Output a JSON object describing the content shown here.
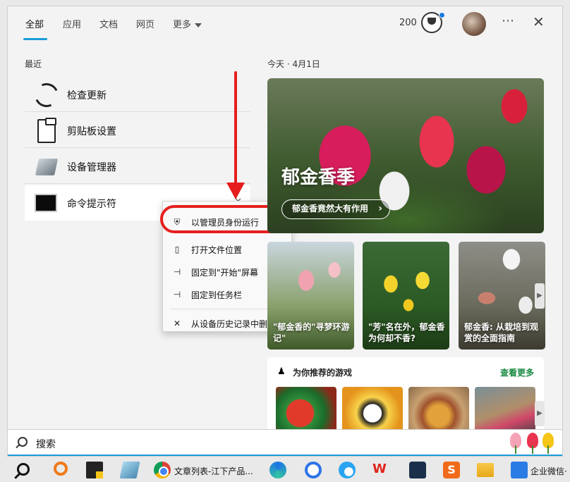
{
  "nav": {
    "tabs": [
      "全部",
      "应用",
      "文档",
      "网页",
      "更多"
    ],
    "points": "200"
  },
  "recent": {
    "label": "最近",
    "items": [
      {
        "label": "检查更新"
      },
      {
        "label": "剪贴板设置"
      },
      {
        "label": "设备管理器"
      },
      {
        "label": "命令提示符"
      }
    ]
  },
  "context_menu": {
    "items": [
      {
        "icon": "⛨",
        "label": "以管理员身份运行"
      },
      {
        "icon": "▯",
        "label": "打开文件位置"
      },
      {
        "icon": "⊣",
        "label": "固定到\"开始\"屏幕"
      },
      {
        "icon": "⊣",
        "label": "固定到任务栏"
      },
      {
        "icon": "✕",
        "label": "从设备历史记录中删除"
      }
    ]
  },
  "today": {
    "label": "今天 · 4月1日",
    "hero_title": "郁金香季",
    "hero_button": "郁金香竟然大有作用",
    "cards": [
      {
        "text": "\"郁金香的\"寻梦环游记\""
      },
      {
        "text": "\"芳\"名在外，郁金香为何却不香?"
      },
      {
        "text": "郁金香: 从栽培到观赏的全面指南"
      }
    ]
  },
  "games": {
    "title": "为你推荐的游戏",
    "more": "查看更多"
  },
  "search": {
    "placeholder": "搜索"
  },
  "taskbar": {
    "chrome_label": "文章列表-江下产品...",
    "wecom_label": "企业微信·"
  }
}
